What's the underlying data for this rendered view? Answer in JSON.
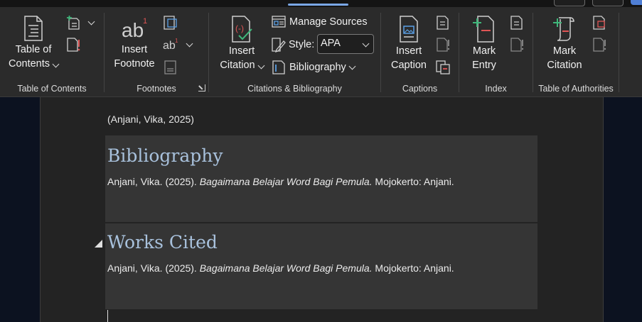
{
  "ribbon": {
    "toc_group": {
      "label": "Table of Contents",
      "button_line1": "Table of",
      "button_line2": "Contents"
    },
    "footnotes_group": {
      "label": "Footnotes",
      "insert_footnote_line1": "Insert",
      "insert_footnote_line2": "Footnote"
    },
    "citations_group": {
      "label": "Citations & Bibliography",
      "insert_citation_line1": "Insert",
      "insert_citation_line2": "Citation",
      "manage_sources": "Manage Sources",
      "style_label": "Style:",
      "style_value": "APA",
      "bibliography": "Bibliography"
    },
    "captions_group": {
      "label": "Captions",
      "insert_caption_line1": "Insert",
      "insert_caption_line2": "Caption"
    },
    "index_group": {
      "label": "Index",
      "mark_entry_line1": "Mark",
      "mark_entry_line2": "Entry"
    },
    "authorities_group": {
      "label": "Table of Authorities",
      "mark_citation_line1": "Mark",
      "mark_citation_line2": "Citation"
    }
  },
  "document": {
    "citation_text": "(Anjani, Vika, 2025)",
    "bibliography": {
      "heading": "Bibliography",
      "entry_prefix": "Anjani, Vika. (2025). ",
      "entry_title": "Bagaimana Belajar Word Bagi Pemula.",
      "entry_suffix": " Mojokerto: Anjani."
    },
    "works_cited": {
      "heading": "Works Cited",
      "entry_prefix": "Anjani, Vika. (2025). ",
      "entry_title": "Bagaimana Belajar Word Bagi Pemula.",
      "entry_suffix": " Mojokerto: Anjani."
    }
  },
  "colors": {
    "ribbon_bg": "#2b2b2b",
    "heading_blue": "#a8c1dc",
    "accent_green": "#3fb67a",
    "accent_red": "#e05555"
  },
  "icons": [
    "toc-icon",
    "add-text-icon",
    "update-table-icon",
    "insert-footnote-icon",
    "insert-endnote-icon",
    "next-footnote-icon",
    "show-notes-icon",
    "insert-citation-icon",
    "manage-sources-icon",
    "style-icon",
    "bibliography-icon",
    "insert-caption-icon",
    "insert-table-of-figures-icon",
    "update-table-icon",
    "cross-reference-icon",
    "mark-entry-icon",
    "insert-index-icon",
    "update-index-icon",
    "mark-citation-icon",
    "insert-table-of-authorities-icon",
    "update-table-of-authorities-icon"
  ]
}
